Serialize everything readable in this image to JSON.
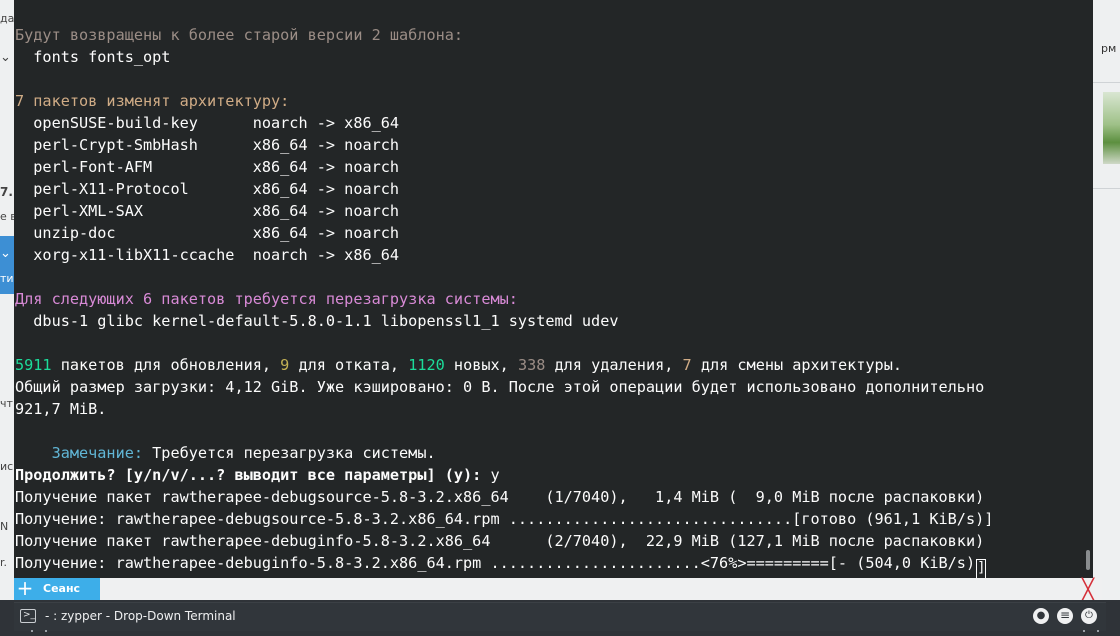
{
  "background_left": {
    "fragments": [
      "да",
      "7.",
      "е в",
      "ти",
      "чт",
      "ис",
      "N",
      "r."
    ],
    "chevrons": [
      "⌄",
      "⌄"
    ]
  },
  "background_right": {
    "fragment": "рм"
  },
  "terminal": {
    "downgrade_header": "Будут возвращены к более старой версии 2 шаблона:",
    "downgrade_items": "  fonts fonts_opt",
    "arch_header": "7 пакетов изменят архитектуру:",
    "arch_rows": [
      "  openSUSE-build-key      noarch -> x86_64",
      "  perl-Crypt-SmbHash      x86_64 -> noarch",
      "  perl-Font-AFM           x86_64 -> noarch",
      "  perl-X11-Protocol       x86_64 -> noarch",
      "  perl-XML-SAX            x86_64 -> noarch",
      "  unzip-doc               x86_64 -> noarch",
      "  xorg-x11-libX11-ccache  noarch -> x86_64"
    ],
    "reboot_header": "Для следующих 6 пакетов требуется перезагрузка системы:",
    "reboot_items": "  dbus-1 glibc kernel-default-5.8.0-1.1 libopenssl1_1 systemd udev",
    "summary": {
      "update_count": "5911",
      "update_text": " пакетов для обновления, ",
      "rollback_count": "9",
      "rollback_text": " для отката, ",
      "new_count": "1120",
      "new_text": " новых, ",
      "remove_count": "338",
      "remove_text": " для удаления, ",
      "arch_count": "7",
      "arch_text": " для смены архитектуры."
    },
    "download_size_line1": "Общий размер загрузки: 4,12 GiB. Уже кэшировано: 0 B. После этой операции будет использовано дополнительно",
    "download_size_line2": "921,7 MiB.",
    "note_label": "    Замечание:",
    "note_text": " Требуется перезагрузка системы.",
    "prompt": "Продолжить? [y/n/v/...? выводит все параметры] (y):",
    "prompt_answer": " y",
    "progress_lines": [
      "Получение пакет rawtherapee-debugsource-5.8-3.2.x86_64    (1/7040),   1,4 MiB (  9,0 MiB после распаковки)",
      "Получение: rawtherapee-debugsource-5.8-3.2.x86_64.rpm ...............................[готово (961,1 KiB/s)]",
      "Получение пакет rawtherapee-debuginfo-5.8-3.2.x86_64      (2/7040),  22,9 MiB (127,1 MiB после распаковки)",
      "Получение: rawtherapee-debuginfo-5.8-3.2.x86_64.rpm .......................<76%>=========[- (504,0 KiB/s)"
    ],
    "last_line_tail": "]"
  },
  "tabbar": {
    "add_label": "+",
    "session_label": "Сеанс",
    "close_label": "╳"
  },
  "window": {
    "icon_glyph": ">_",
    "title": "- : zypper - Drop-Down Terminal",
    "btn_dot": "●",
    "btn_menu": "≡",
    "btn_quit": "⏻"
  }
}
